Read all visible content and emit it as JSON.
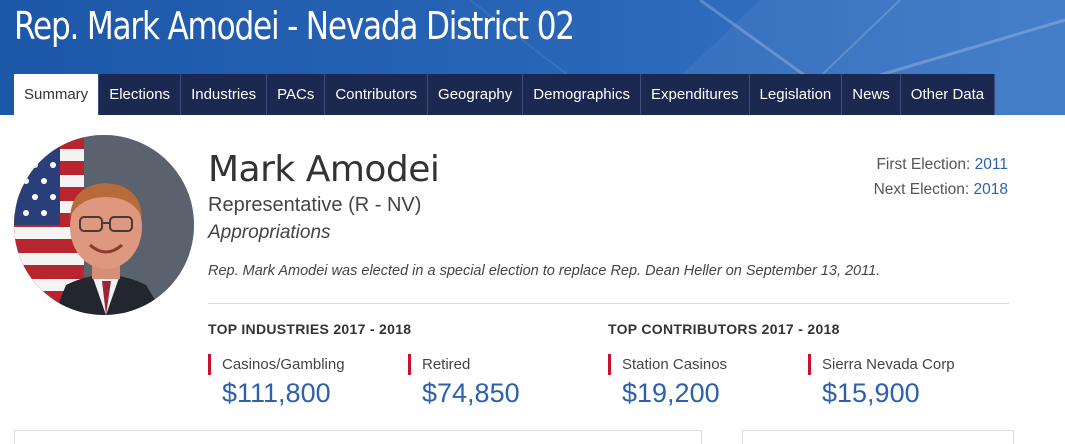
{
  "banner": {
    "title": "Rep. Mark Amodei - Nevada District 02"
  },
  "tabs": [
    {
      "label": "Summary"
    },
    {
      "label": "Elections"
    },
    {
      "label": "Industries"
    },
    {
      "label": "PACs"
    },
    {
      "label": "Contributors"
    },
    {
      "label": "Geography"
    },
    {
      "label": "Demographics"
    },
    {
      "label": "Expenditures"
    },
    {
      "label": "Legislation"
    },
    {
      "label": "News"
    },
    {
      "label": "Other Data"
    }
  ],
  "active_tab": "Summary",
  "profile": {
    "name": "Mark Amodei",
    "role": "Representative (R - NV)",
    "committee": "Appropriations",
    "bio": "Rep. Mark Amodei was elected in a special election to replace Rep. Dean Heller on September 13, 2011."
  },
  "elections": {
    "first_label": "First Election: ",
    "first_value": "2011",
    "next_label": "Next Election: ",
    "next_value": "2018"
  },
  "top_industries": {
    "heading": "TOP INDUSTRIES 2017 - 2018",
    "items": [
      {
        "label": "Casinos/Gambling",
        "amount": "$111,800"
      },
      {
        "label": "Retired",
        "amount": "$74,850"
      }
    ]
  },
  "top_contributors": {
    "heading": "TOP CONTRIBUTORS 2017 - 2018",
    "items": [
      {
        "label": "Station Casinos",
        "amount": "$19,200"
      },
      {
        "label": "Sierra Nevada Corp",
        "amount": "$15,900"
      }
    ]
  },
  "colors": {
    "banner_blue": "#1c57a8",
    "tab_navy": "#1b2950",
    "accent_red": "#c8102e",
    "link_blue": "#2c61ad"
  }
}
